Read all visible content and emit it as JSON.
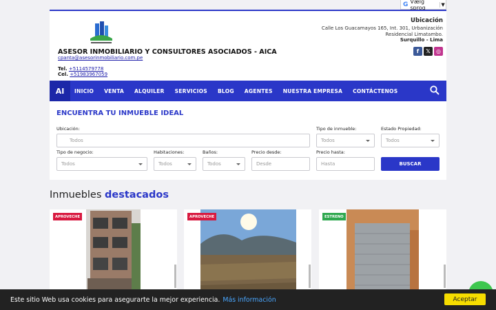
{
  "language": {
    "label": "Vælg sprog",
    "caret": "▼"
  },
  "header": {
    "company": "ASESOR INMOBILIARIO Y CONSULTORES ASOCIADOS - AICA",
    "email": "cpanta@asesorinmobiliario.com.pe",
    "tel_label": "Tel.",
    "tel": "+5114579778",
    "cel_label": "Cel.",
    "cel": "+51983967059",
    "location_title": "Ubicación",
    "address": "Calle Los Guacamayos 165, Int. 301, Urbanización Residencial Limatambo.",
    "city": "Surquillo - Lima",
    "social": [
      {
        "name": "facebook",
        "glyph": "f",
        "color": "#3b5998"
      },
      {
        "name": "x",
        "glyph": "𝕏",
        "color": "#222222"
      },
      {
        "name": "instagram",
        "glyph": "◎",
        "color": "#c1358f"
      }
    ]
  },
  "nav": {
    "brand": "AI",
    "items": [
      "INICIO",
      "VENTA",
      "ALQUILER",
      "SERVICIOS",
      "BLOG",
      "AGENTES",
      "NUESTRA EMPRESA",
      "CONTÁCTENOS"
    ]
  },
  "finder": {
    "title": "ENCUENTRA TU INMUEBLE IDEAL",
    "ubicacion_label": "Ubicación:",
    "ubicacion_placeholder": "Todos",
    "tipo_label": "Tipo de inmueble:",
    "tipo_value": "Todos",
    "estado_label": "Estado Propiedad:",
    "estado_value": "Todos",
    "negocio_label": "Tipo de negocio:",
    "negocio_value": "Todos",
    "hab_label": "Habitaciones:",
    "hab_value": "Todos",
    "banos_label": "Baños:",
    "banos_value": "Todos",
    "desde_label": "Precio desde:",
    "desde_placeholder": "Desde",
    "hasta_label": "Precio hasta:",
    "hasta_placeholder": "Hasta",
    "search_button": "BUSCAR"
  },
  "featured": {
    "title_plain": "Inmuebles",
    "title_accent": "destacados",
    "cards": [
      {
        "tag": "APROVECHE",
        "tag_color": "#d8193f"
      },
      {
        "tag": "APROVECHE",
        "tag_color": "#d8193f"
      },
      {
        "tag": "ESTRENO",
        "tag_color": "#2fa84f"
      }
    ]
  },
  "cookie": {
    "text": "Este sitio Web usa cookies para asegurarte la mejor experiencia.",
    "link": "Más información",
    "accept": "Aceptar"
  },
  "colors": {
    "brand": "#2a37c8",
    "cookie_bg": "#222222",
    "accept": "#f6dd00"
  }
}
